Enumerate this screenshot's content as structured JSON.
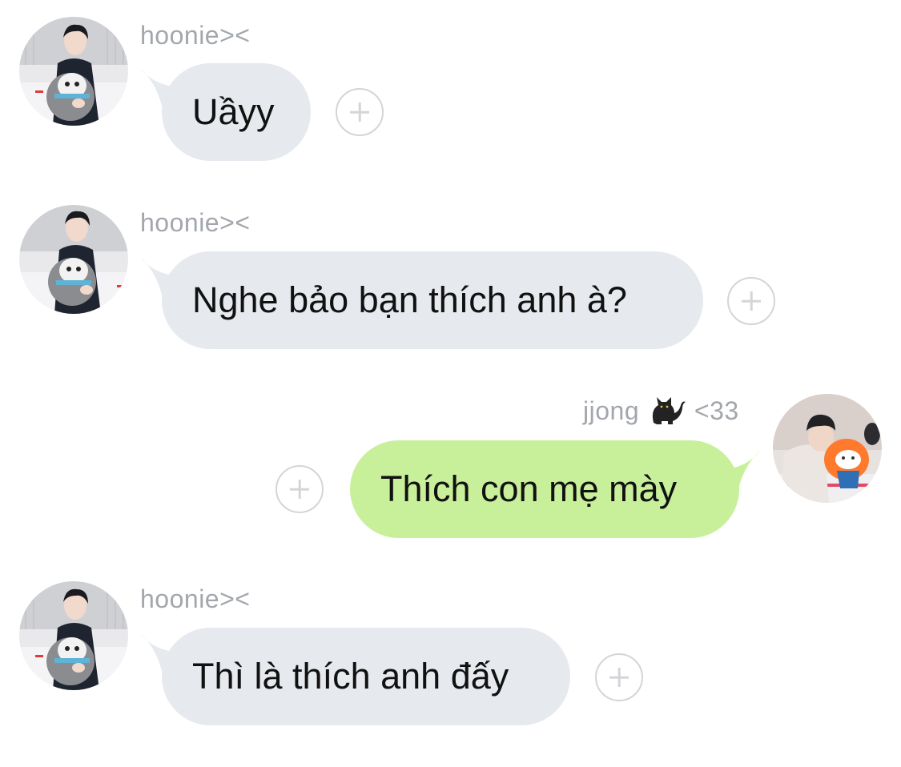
{
  "messages": [
    {
      "sender": "hoonie><",
      "text": "Uầyy",
      "direction": "incoming"
    },
    {
      "sender": "hoonie><",
      "text": "Nghe bảo bạn thích anh à?",
      "direction": "incoming"
    },
    {
      "sender": "jjong 🐈‍⬛ <33",
      "sender_name": "jjong",
      "sender_emoji": "black-cat",
      "sender_suffix": "<33",
      "text": "Thích con mẹ mày",
      "direction": "outgoing"
    },
    {
      "sender": "hoonie><",
      "text": "Thì là thích anh đấy",
      "direction": "incoming"
    }
  ],
  "colors": {
    "incoming_bubble": "#e6e9ed",
    "outgoing_bubble": "#c8f09b",
    "sender_text": "#a3a7ac",
    "message_text": "#111111",
    "reaction_icon": "#d3d5d8"
  }
}
